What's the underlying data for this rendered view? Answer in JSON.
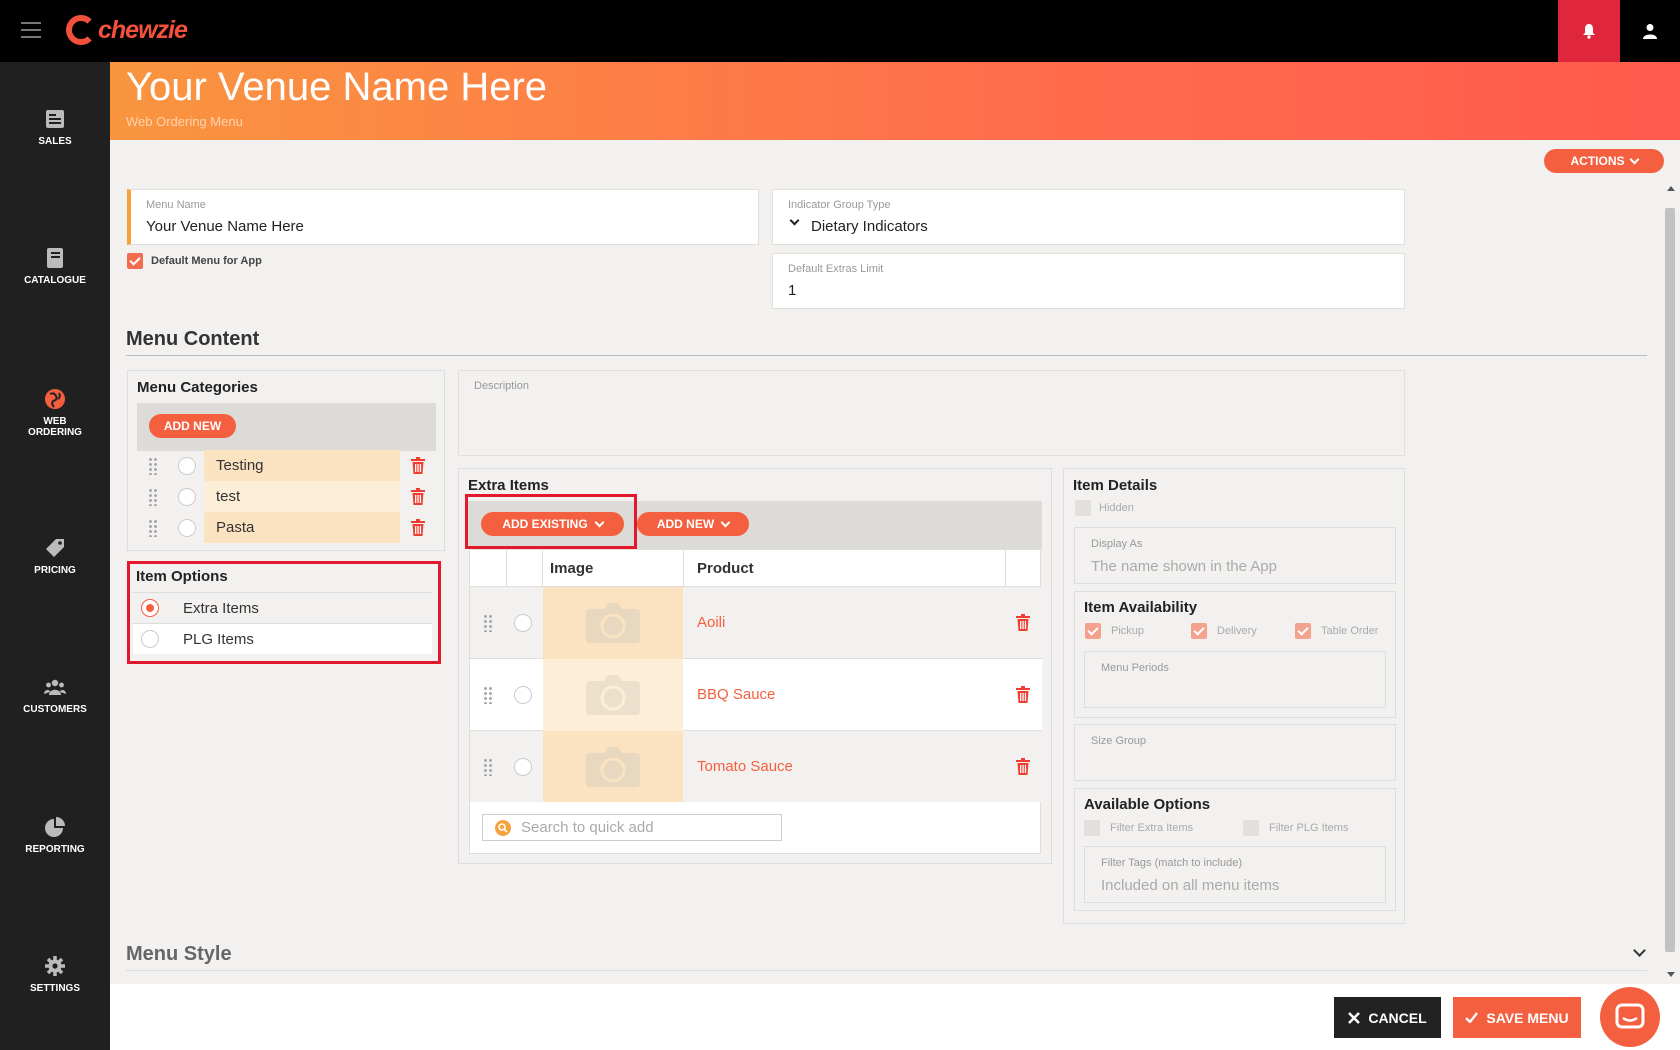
{
  "topbar": {
    "logo_text": "chewzie"
  },
  "sidebar": {
    "items": [
      {
        "label": "SALES",
        "icon": "sales-icon"
      },
      {
        "label": "CATALOGUE",
        "icon": "catalogue-icon"
      },
      {
        "label": "WEB",
        "label2": "ORDERING",
        "icon": "globe-icon"
      },
      {
        "label": "PRICING",
        "icon": "tag-icon"
      },
      {
        "label": "CUSTOMERS",
        "icon": "people-icon"
      },
      {
        "label": "REPORTING",
        "icon": "pie-chart-icon"
      },
      {
        "label": "SETTINGS",
        "icon": "gear-icon"
      }
    ]
  },
  "header": {
    "title": "Your Venue Name Here",
    "subtitle": "Web Ordering Menu"
  },
  "actions": {
    "label": "ACTIONS"
  },
  "form": {
    "menu_name_label": "Menu Name",
    "menu_name_value": "Your Venue Name Here",
    "default_menu_label": "Default Menu for App",
    "indicator_group_label": "Indicator Group Type",
    "indicator_group_value": "Dietary Indicators",
    "extras_limit_label": "Default Extras Limit",
    "extras_limit_value": "1"
  },
  "menu_content": {
    "title": "Menu Content",
    "categories": {
      "title": "Menu Categories",
      "add_new": "ADD NEW",
      "items": [
        "Testing",
        "test",
        "Pasta"
      ]
    },
    "item_options": {
      "title": "Item Options",
      "items": [
        "Extra Items",
        "PLG Items"
      ],
      "selected": "Extra Items"
    },
    "description_label": "Description",
    "extra_items": {
      "title": "Extra Items",
      "add_existing": "ADD EXISTING",
      "add_new": "ADD NEW",
      "col_image": "Image",
      "col_product": "Product",
      "rows": [
        "Aoili",
        "BBQ Sauce",
        "Tomato Sauce"
      ],
      "search_placeholder": "Search to quick add"
    },
    "item_details": {
      "title": "Item Details",
      "hidden_label": "Hidden",
      "display_as_label": "Display As",
      "display_as_placeholder": "The name shown in the App",
      "availability_title": "Item Availability",
      "pickup": "Pickup",
      "delivery": "Delivery",
      "table_order": "Table Order",
      "menu_periods": "Menu Periods",
      "size_group": "Size Group",
      "available_options_title": "Available Options",
      "filter_extra": "Filter Extra Items",
      "filter_plg": "Filter PLG Items",
      "filter_tags_label": "Filter Tags (match to include)",
      "filter_tags_value": "Included on all menu items"
    }
  },
  "menu_style": {
    "title": "Menu Style"
  },
  "footer": {
    "cancel": "CANCEL",
    "save": "SAVE MENU"
  },
  "colors": {
    "accent": "#f4603f",
    "bell": "#e0263d",
    "highlight": "#e3182d"
  }
}
